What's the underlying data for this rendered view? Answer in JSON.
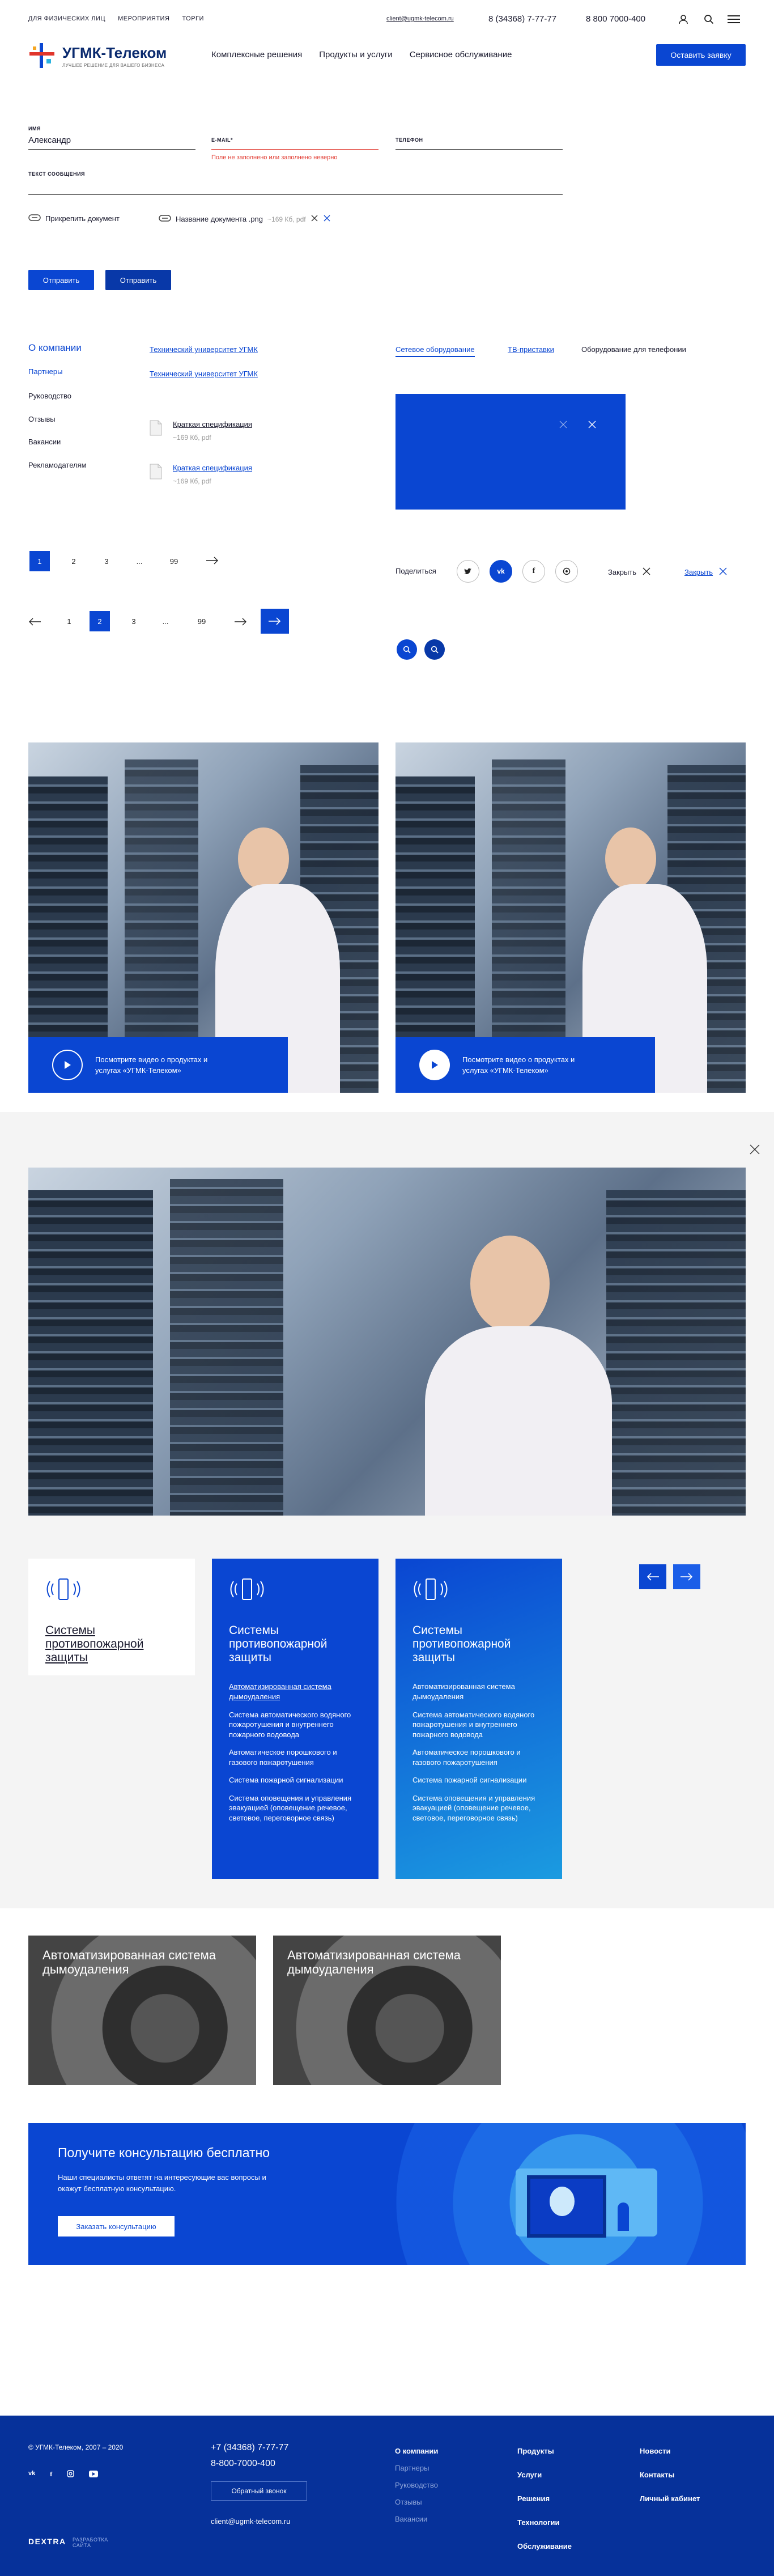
{
  "topbar": {
    "links": [
      "ДЛЯ ФИЗИЧЕСКИХ ЛИЦ",
      "МЕРОПРИЯТИЯ",
      "ТОРГИ"
    ],
    "email": "client@ugmk-telecom.ru",
    "phone1": "8 (34368) 7-77-77",
    "phone2": "8 800 7000-400"
  },
  "header": {
    "logo_text": "УГМК-Телеком",
    "logo_sub": "ЛУЧШЕЕ РЕШЕНИЕ ДЛЯ ВАШЕГО БИЗНЕСА",
    "nav": [
      "Комплексные решения",
      "Продукты и услуги",
      "Сервисное обслуживание"
    ],
    "cta": "Оставить заявку"
  },
  "form": {
    "name_label": "ИМЯ",
    "name_value": "Александр",
    "email_label": "E-MAIL*",
    "email_error": "Поле не заполнено или заполнено неверно",
    "phone_label": "ТЕЛЕФОН",
    "message_label": "ТЕКСТ СООБЩЕНИЯ",
    "attach": "Прикрепить документ",
    "file_name": "Название документа .png",
    "file_size": "~169 Кб, pdf",
    "submit1": "Отправить",
    "submit2": "Отправить"
  },
  "side_menu": {
    "items": [
      "О компании",
      "Партнеры",
      "Руководство",
      "Отзывы",
      "Вакансии",
      "Рекламодателям"
    ]
  },
  "links_col": [
    "Технический университет УГМК",
    "Технический университет УГМК"
  ],
  "docs": [
    {
      "title": "Краткая спецификация",
      "meta": "~169 Кб, pdf"
    },
    {
      "title": "Краткая спецификация",
      "meta": "~169 Кб, pdf"
    }
  ],
  "tabs": [
    "Сетевое оборудование",
    "ТВ-приставки",
    "Оборудование для телефонии"
  ],
  "pagination1": [
    "1",
    "2",
    "3",
    "...",
    "99"
  ],
  "pagination2": [
    "1",
    "2",
    "3",
    "...",
    "99"
  ],
  "share": {
    "label": "Поделиться",
    "buttons": [
      "tw",
      "vk",
      "f",
      "ok"
    ],
    "close1": "Закрыть",
    "close2": "Закрыть"
  },
  "video_caption": "Посмотрите видео о продуктах и услугах «УГМК-Телеком»",
  "services": {
    "card_title": "Системы противопожарной защиты",
    "items": [
      "Автоматизированная система дымоудаления",
      "Система автоматического водяного пожаротушения и внутреннего пожарного водовода",
      "Автоматическое порошкового и газового пожаротушения",
      "Система пожарной сигнализации",
      "Система оповещения и управления эвакуацией (оповещение речевое, световое, переговорное связь)"
    ]
  },
  "fan_cards": [
    "Автоматизированная система дымоудаления",
    "Автоматизированная система дымоудаления"
  ],
  "consult": {
    "title": "Получите консультацию бесплатно",
    "text": "Наши специалисты ответят на интересующие вас вопросы и окажут бесплатную консультацию.",
    "button": "Заказать консультацию"
  },
  "footer": {
    "copyright": "© УГМК-Телеком, 2007 – 2020",
    "phone1": "+7 (34368) 7-77-77",
    "phone2": "8-800-7000-400",
    "callback": "Обратный звонок",
    "email": "client@ugmk-telecom.ru",
    "dev_logo": "DEXTRA",
    "dev_text": "РАЗРАБОТКА САЙТА",
    "col1": [
      "О компании",
      "Партнеры",
      "Руководство",
      "Отзывы",
      "Вакансии"
    ],
    "col2": [
      "Продукты",
      "Услуги",
      "Решения",
      "Технологии",
      "Обслуживание"
    ],
    "col3": [
      "Новости",
      "Контакты",
      "Личный кабинет"
    ]
  },
  "colors": {
    "accent": "#0a46d2",
    "footer_bg": "#06319a",
    "error": "#e0352b",
    "gray_bg": "#f4f4f4"
  }
}
